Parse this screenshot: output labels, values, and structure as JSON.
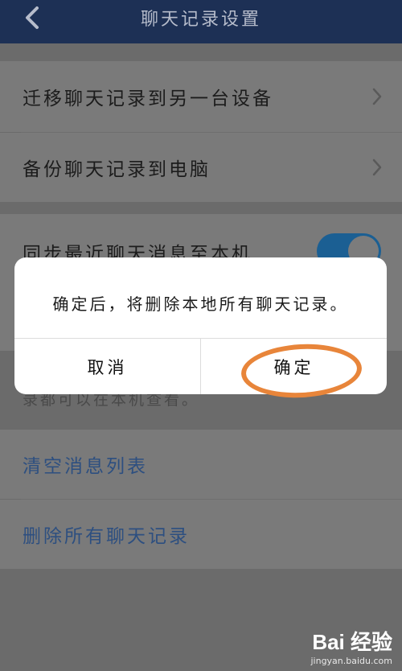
{
  "header": {
    "title": "聊天记录设置",
    "back_icon": "chevron-left-icon"
  },
  "settings": {
    "item_migrate": "迁移聊天记录到另一台设备",
    "item_backup": "备份聊天记录到电脑",
    "item_sync": "同步最近聊天消息至本机",
    "sync_enabled": true,
    "hint": "录都可以在本机查看。",
    "clear_list": "清空消息列表",
    "delete_all": "删除所有聊天记录"
  },
  "dialog": {
    "message": "确定后，将删除本地所有聊天记录。",
    "cancel_label": "取消",
    "confirm_label": "确定"
  },
  "watermark": {
    "brand": "Bai 经验",
    "url": "jingyan.baidu.com"
  },
  "colors": {
    "header_bg": "#1d3055",
    "highlight": "#e8853a",
    "toggle_on": "#1b5f93",
    "link": "#2d4f80"
  }
}
